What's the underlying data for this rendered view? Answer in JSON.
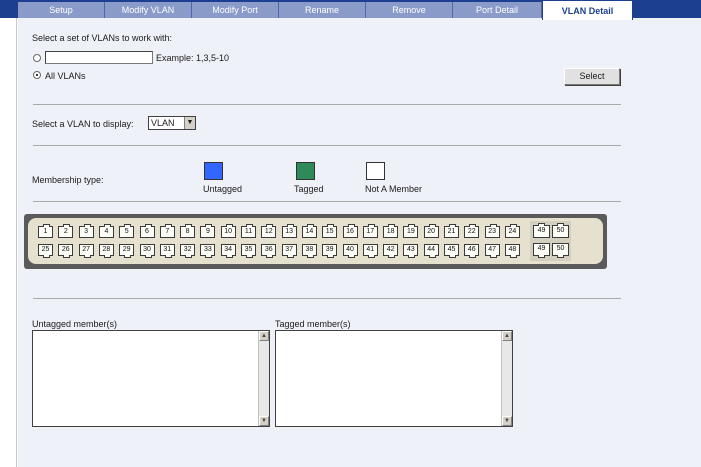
{
  "tabs": [
    {
      "label": "Setup"
    },
    {
      "label": "Modify VLAN"
    },
    {
      "label": "Modify Port"
    },
    {
      "label": "Rename"
    },
    {
      "label": "Remove"
    },
    {
      "label": "Port Detail"
    },
    {
      "label": "VLAN Detail",
      "active": true
    }
  ],
  "vlan_set": {
    "heading": "Select a set of VLANs to work with:",
    "custom_value": "",
    "example": "Example: 1,3,5-10",
    "all_label": "All VLANs",
    "selected_option": "All VLANs",
    "select_button": "Select"
  },
  "display": {
    "label": "Select a VLAN to display:",
    "value": "VLAN"
  },
  "membership": {
    "label": "Membership type:",
    "types": [
      {
        "name": "Untagged",
        "color": "#3366ff"
      },
      {
        "name": "Tagged",
        "color": "#2e8b57"
      },
      {
        "name": "Not A Member",
        "color": "#ffffff"
      }
    ]
  },
  "ports": {
    "top_row": [
      "1",
      "2",
      "3",
      "4",
      "5",
      "6",
      "7",
      "8",
      "9",
      "10",
      "11",
      "12",
      "13",
      "14",
      "15",
      "16",
      "17",
      "18",
      "19",
      "20",
      "21",
      "22",
      "23",
      "24"
    ],
    "bottom_row": [
      "25",
      "26",
      "27",
      "28",
      "29",
      "30",
      "31",
      "32",
      "33",
      "34",
      "35",
      "36",
      "37",
      "38",
      "39",
      "40",
      "41",
      "42",
      "43",
      "44",
      "45",
      "46",
      "47",
      "48"
    ],
    "uplink_top": [
      "49",
      "50"
    ],
    "uplink_bottom": [
      "49",
      "50"
    ]
  },
  "members": {
    "untagged_label": "Untagged member(s)",
    "tagged_label": "Tagged member(s)",
    "untagged": "",
    "tagged": ""
  },
  "colors": {
    "tab_bar": "#1c3f8f",
    "tab_inactive": "#8a9bc9",
    "panel": "#eef1f8"
  }
}
